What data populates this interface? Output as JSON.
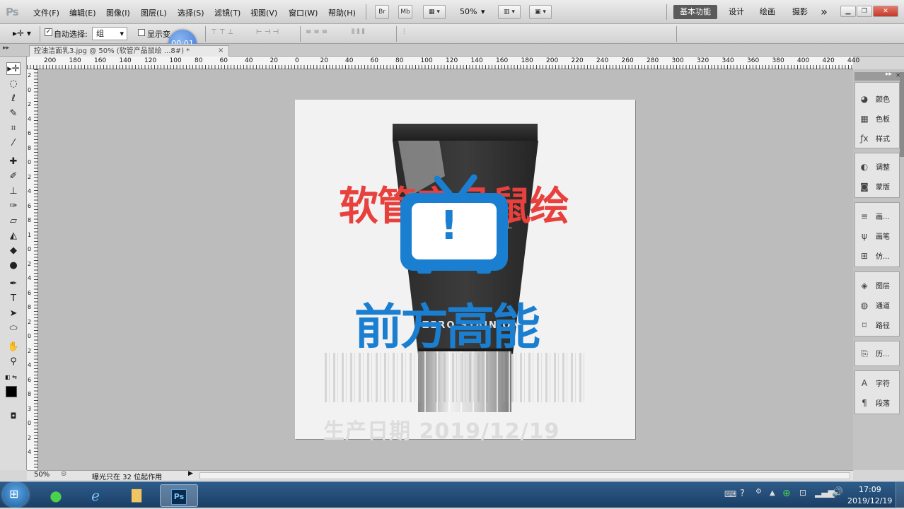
{
  "app": {
    "logo": "Ps"
  },
  "menu": [
    "文件(F)",
    "编辑(E)",
    "图像(I)",
    "图层(L)",
    "选择(S)",
    "滤镜(T)",
    "视图(V)",
    "窗口(W)",
    "帮助(H)"
  ],
  "app_bar": {
    "br": "Br",
    "mb": "Mb",
    "zoom": "50%"
  },
  "workspaces": [
    "基本功能",
    "设计",
    "绘画",
    "摄影"
  ],
  "more_glyph": "»",
  "options": {
    "auto_select_label": "自动选择:",
    "auto_select_value": "组",
    "show_transform_label": "显示变"
  },
  "recording_timer": "00:01",
  "document": {
    "tab_title": "控油洁面乳3.jpg @ 50% (软管产品鼠绘 ...8#) *",
    "close_glyph": "×"
  },
  "ruler_h": [
    "200",
    "180",
    "160",
    "140",
    "120",
    "100",
    "80",
    "60",
    "40",
    "20",
    "0",
    "20",
    "40",
    "60",
    "80",
    "100",
    "120",
    "140",
    "160",
    "180",
    "200",
    "220",
    "240",
    "260",
    "280",
    "300",
    "320",
    "340",
    "360",
    "380",
    "400",
    "420",
    "440"
  ],
  "ruler_v": [
    "2",
    "0",
    "2",
    "4",
    "6",
    "8",
    "0",
    "2",
    "4",
    "6",
    "8",
    "1",
    "0",
    "2",
    "4",
    "6",
    "8",
    "2",
    "0",
    "2",
    "4",
    "6",
    "8",
    "3",
    "0",
    "2",
    "4"
  ],
  "artwork": {
    "headline": "软管产品鼠绘",
    "watermark_text": "前方高能",
    "label_text": "ZERO STAIN ON",
    "label_small": "L",
    "date_text": "生产日期 2019/12/19",
    "warning_glyph": "!"
  },
  "status": {
    "zoom": "50%",
    "message": "曝光只在 32 位起作用"
  },
  "panels": {
    "group1": [
      {
        "icon": "palette-icon",
        "glyph": "◕",
        "label": "颜色"
      },
      {
        "icon": "swatches-icon",
        "glyph": "▦",
        "label": "色板"
      },
      {
        "icon": "styles-icon",
        "glyph": "ƒx",
        "label": "样式"
      }
    ],
    "group2": [
      {
        "icon": "adjust-icon",
        "glyph": "◐",
        "label": "调整"
      },
      {
        "icon": "mask-icon",
        "glyph": "◙",
        "label": "蒙版"
      }
    ],
    "group3": [
      {
        "icon": "brush-preset-icon",
        "glyph": "≡",
        "label": "画..."
      },
      {
        "icon": "brush-icon",
        "glyph": "ψ",
        "label": "画笔"
      },
      {
        "icon": "clone-source-icon",
        "glyph": "⊞",
        "label": "仿..."
      }
    ],
    "group4": [
      {
        "icon": "layers-icon",
        "glyph": "◈",
        "label": "图层"
      },
      {
        "icon": "channels-icon",
        "glyph": "◍",
        "label": "通道"
      },
      {
        "icon": "paths-icon",
        "glyph": "⌑",
        "label": "路径"
      }
    ],
    "group5": [
      {
        "icon": "history-icon",
        "glyph": "⎘",
        "label": "历..."
      }
    ],
    "group6": [
      {
        "icon": "character-icon",
        "glyph": "A",
        "label": "字符"
      },
      {
        "icon": "paragraph-icon",
        "glyph": "¶",
        "label": "段落"
      }
    ]
  },
  "taskbar": {
    "time": "17:09",
    "date": "2019/12/19",
    "ps": "Ps"
  },
  "colors": {
    "headline": "#e8403c",
    "watermark": "#1a7fd1",
    "tube_dark": "#2a2a2a",
    "canvas_bg": "#f2f2f2",
    "workspace": "#bcbcbc"
  }
}
